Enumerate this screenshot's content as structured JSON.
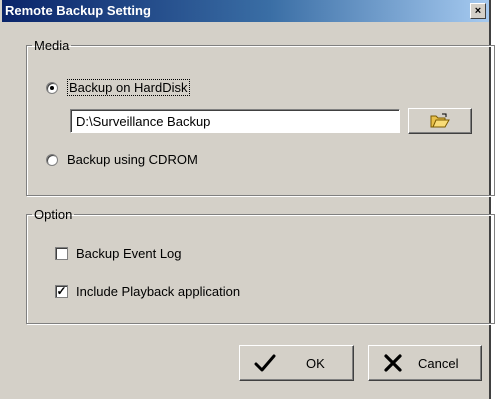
{
  "window": {
    "title": "Remote Backup Setting",
    "close_glyph": "×"
  },
  "media": {
    "legend": "Media",
    "harddisk_label": "Backup on HardDisk",
    "harddisk_selected": true,
    "path_value": "D:\\Surveillance Backup",
    "browse_icon": "open-folder-icon",
    "cdrom_label": "Backup using CDROM",
    "cdrom_selected": false
  },
  "option": {
    "legend": "Option",
    "event_log_label": "Backup Event Log",
    "event_log_checked": false,
    "playback_label": "Include Playback application",
    "playback_checked": true,
    "check_glyph": "✓"
  },
  "buttons": {
    "ok_label": "OK",
    "ok_icon": "checkmark-icon",
    "cancel_label": "Cancel",
    "cancel_icon": "x-icon"
  },
  "colors": {
    "dialog_face": "#d4d0c8",
    "title_start": "#0a246a",
    "title_end": "#a6caf0"
  }
}
